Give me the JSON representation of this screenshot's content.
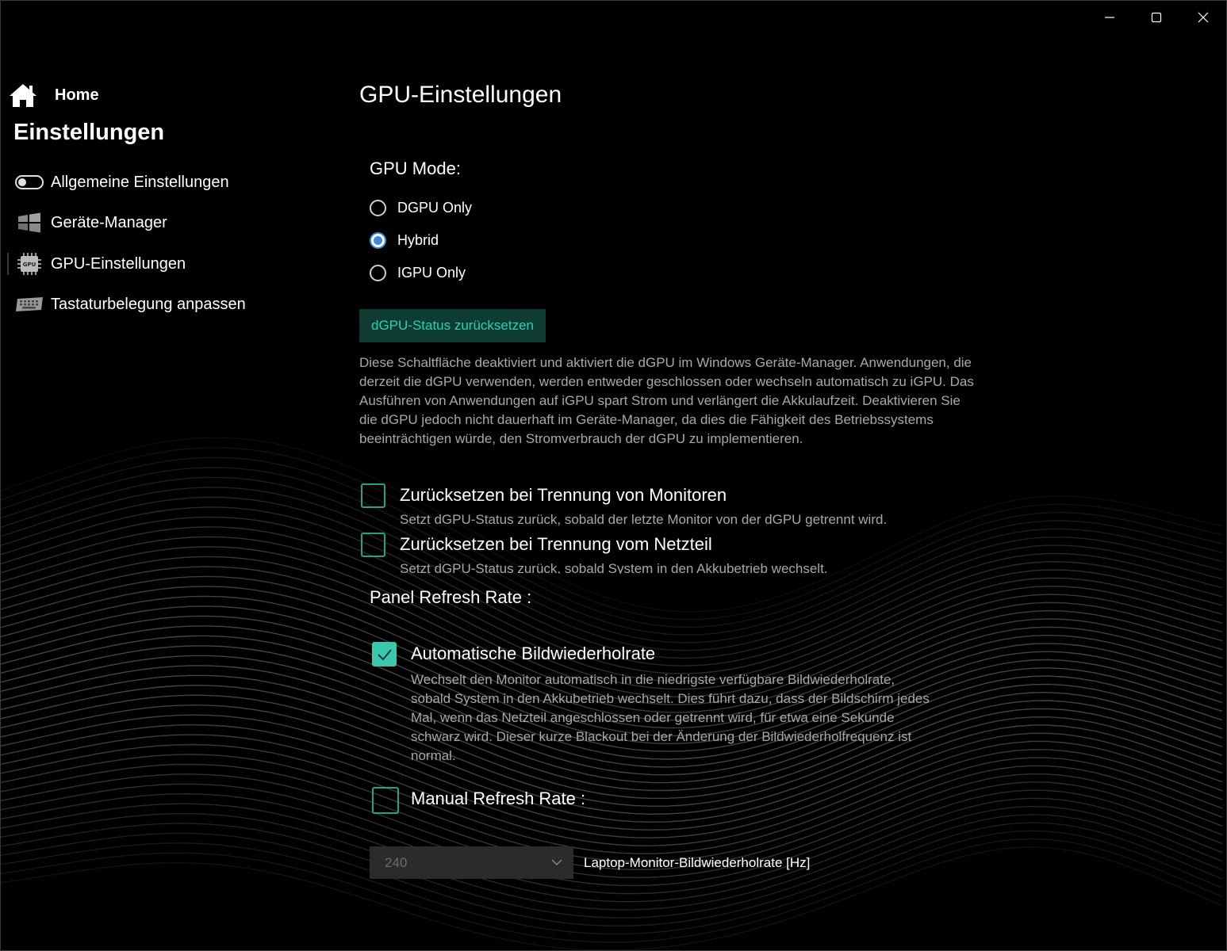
{
  "window": {
    "controls": [
      "minimize",
      "maximize",
      "close"
    ]
  },
  "sidebar": {
    "home_label": "Home",
    "section_title": "Einstellungen",
    "items": [
      {
        "label": "Allgemeine Einstellungen",
        "icon": "toggle-icon"
      },
      {
        "label": "Geräte-Manager",
        "icon": "windows-icon"
      },
      {
        "label": "GPU-Einstellungen",
        "icon": "gpu-chip-icon",
        "selected": true
      },
      {
        "label": "Tastaturbelegung anpassen",
        "icon": "keyboard-icon"
      }
    ]
  },
  "main": {
    "title": "GPU-Einstellungen",
    "gpu_mode": {
      "label": "GPU Mode:",
      "options": [
        "DGPU Only",
        "Hybrid",
        "IGPU Only"
      ],
      "selected": "Hybrid"
    },
    "reset_button": "dGPU-Status zurücksetzen",
    "description": "Diese Schaltfläche deaktiviert und aktiviert die dGPU im Windows Geräte-Manager. Anwendungen, die derzeit die dGPU verwenden, werden entweder geschlossen oder wechseln automatisch zu iGPU. Das Ausführen von Anwendungen auf iGPU spart Strom und verlängert die Akkulaufzeit. Deaktivieren Sie die dGPU jedoch nicht dauerhaft im Geräte-Manager, da dies die Fähigkeit des Betriebssystems beeinträchtigen würde, den Stromverbrauch der dGPU zu implementieren.",
    "reset_on_monitor": {
      "title": "Zurücksetzen bei Trennung von Monitoren",
      "subtitle": "Setzt dGPU-Status zurück, sobald der letzte Monitor von der dGPU getrennt wird.",
      "checked": false
    },
    "reset_on_power": {
      "title": "Zurücksetzen bei Trennung vom Netzteil",
      "subtitle": "Setzt dGPU-Status zurück, sobald System in den Akkubetrieb wechselt.",
      "checked": false
    },
    "panel_refresh": {
      "label": "Panel Refresh Rate :",
      "auto": {
        "title": "Automatische Bildwiederholrate",
        "subtitle": "Wechselt den Monitor automatisch in die niedrigste verfügbare Bildwiederholrate, sobald System in den Akkubetrieb wechselt. Dies führt dazu, dass der Bildschirm jedes Mal, wenn das Netzteil angeschlossen oder getrennt wird, für etwa eine Sekunde schwarz wird. Dieser kurze Blackout bei der Änderung der Bildwiederholfrequenz ist normal.",
        "checked": true
      },
      "manual": {
        "title": "Manual Refresh Rate :",
        "checked": false
      },
      "rate_value": "240",
      "rate_label": "Laptop-Monitor-Bildwiederholrate [Hz]"
    }
  },
  "colors": {
    "accent_teal": "#3cc7ad",
    "radio_blue": "#3d8bd8",
    "button_bg": "#0e3c33",
    "button_text": "#2fd0b0"
  }
}
